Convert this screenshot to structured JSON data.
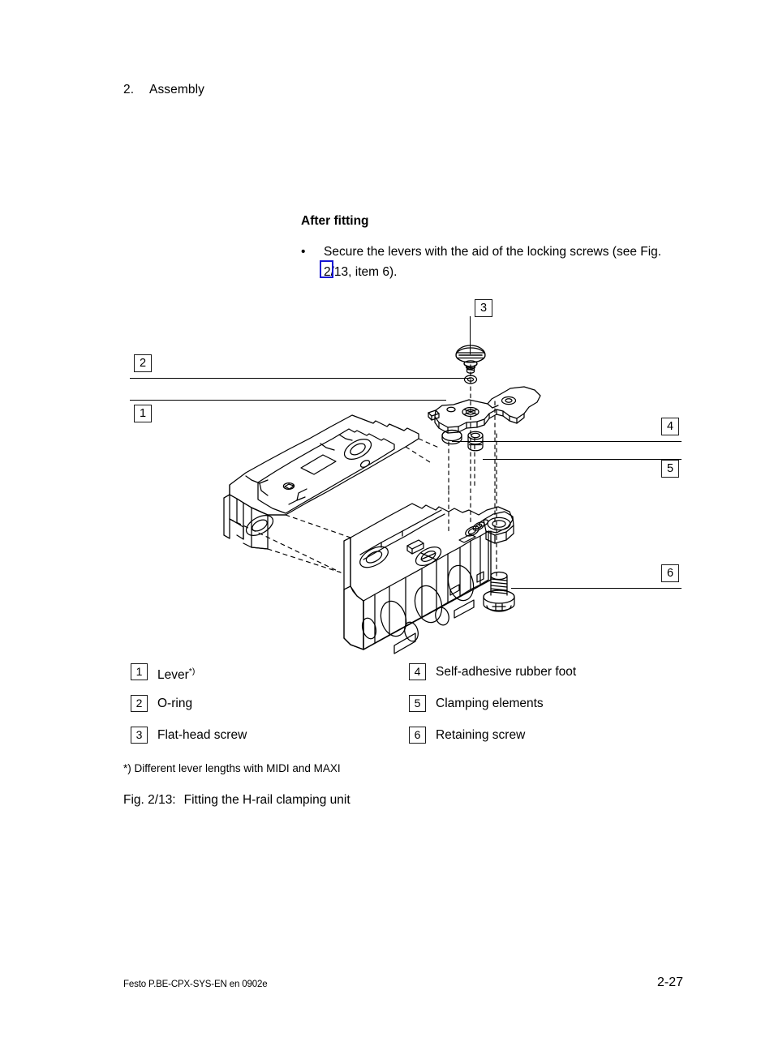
{
  "header": {
    "chapter_number": "2.",
    "chapter_title": "Assembly"
  },
  "section": {
    "title": "After fitting",
    "bullet_marker": "•",
    "bullet_text": "Secure the levers with the aid of the locking screws (see Fig. 2/13, item 6)."
  },
  "diagram": {
    "callouts": [
      {
        "id": "1",
        "number": "1"
      },
      {
        "id": "2",
        "number": "2"
      },
      {
        "id": "3",
        "number": "3"
      },
      {
        "id": "4",
        "number": "4"
      },
      {
        "id": "5",
        "number": "5"
      },
      {
        "id": "6",
        "number": "6"
      }
    ]
  },
  "legend": {
    "left": [
      {
        "number": "1",
        "label": "Lever",
        "superscript": "*)"
      },
      {
        "number": "2",
        "label": "O-ring",
        "superscript": ""
      },
      {
        "number": "3",
        "label": "Flat-head screw",
        "superscript": ""
      }
    ],
    "right": [
      {
        "number": "4",
        "label": "Self-adhesive rubber foot",
        "superscript": ""
      },
      {
        "number": "5",
        "label": "Clamping elements",
        "superscript": ""
      },
      {
        "number": "6",
        "label": "Retaining screw",
        "superscript": ""
      }
    ]
  },
  "footnote": "*) Different lever lengths with MIDI and MAXI",
  "figure": {
    "number": "Fig. 2/13:",
    "caption": "Fitting the H-rail clamping unit"
  },
  "footer": {
    "document_id": "Festo P.BE-CPX-SYS-EN  en 0902e",
    "page_number": "2-27"
  },
  "colors": {
    "link_annotation": "#1414d2",
    "line": "#000000",
    "text": "#000000"
  }
}
